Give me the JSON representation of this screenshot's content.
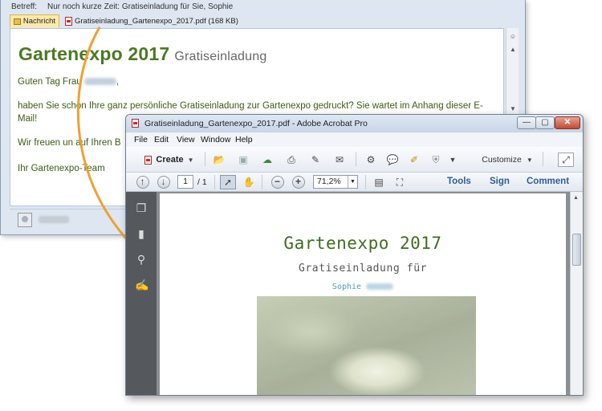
{
  "mail": {
    "subject_label": "Betreff:",
    "subject_value": "Nur noch kurze Zeit: Gratiseinladung für Sie, Sophie",
    "tab_message": "Nachricht",
    "attachment_name": "Gratiseinladung_Gartenexpo_2017.pdf (168 KB)",
    "heading": "Gartenexpo 2017",
    "heading_sub": "Gratiseinladung",
    "greeting": "Guten Tag Frau",
    "greeting_end": ",",
    "para1": "haben Sie schon Ihre ganz persönliche Gratiseinladung zur Gartenexpo gedruckt? Sie wartet im Anhang dieser E-Mail!",
    "para2_start": "Wir freuen un",
    "para2_end": "auf Ihren B",
    "signoff": "Ihr Gartenexpo-Team"
  },
  "acrobat": {
    "title": "Gratiseinladung_Gartenexpo_2017.pdf - Adobe Acrobat Pro",
    "window_minimize": "—",
    "window_maximize": "▢",
    "window_close": "✕",
    "menu": [
      "File",
      "Edit",
      "View",
      "Window",
      "Help"
    ],
    "create_label": "Create",
    "customize_label": "Customize",
    "page_current": "1",
    "page_total": "/ 1",
    "zoom": "71,2%",
    "tab_tools": "Tools",
    "tab_sign": "Sign",
    "tab_comment": "Comment"
  },
  "document": {
    "title": "Gartenexpo 2017",
    "subtitle": "Gratiseinladung für",
    "name": "Sophie"
  },
  "icons": {
    "arrow_color": "#f0a030"
  }
}
